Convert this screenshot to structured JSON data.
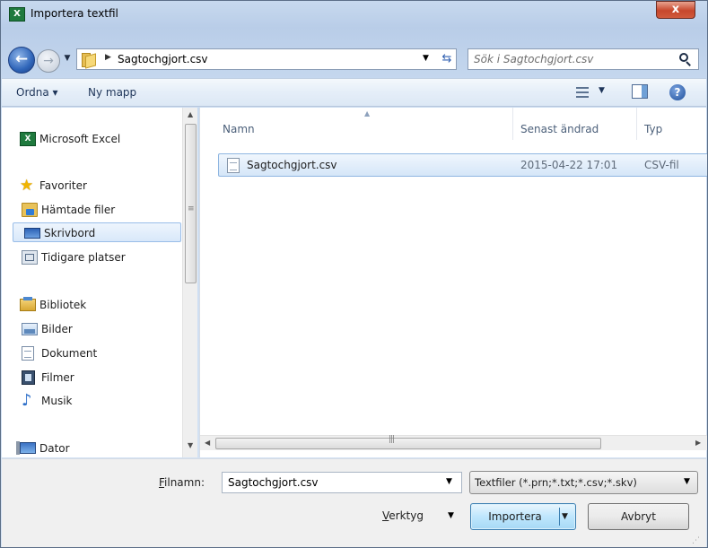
{
  "window": {
    "title": "Importera textfil",
    "app_icon": "excel-icon",
    "close_label": "x"
  },
  "address_bar": {
    "path": "Sagtochgjort.csv",
    "search_placeholder": "Sök i Sagtochgjort.csv"
  },
  "toolbar": {
    "organize_label": "Ordna ▾",
    "new_folder_label": "Ny mapp"
  },
  "nav": {
    "items": [
      {
        "label": "Microsoft Excel",
        "icon": "excel-icon"
      },
      {
        "label": "Favoriter",
        "icon": "star-icon"
      },
      {
        "label": "Hämtade filer",
        "icon": "downloads-folder-icon"
      },
      {
        "label": "Skrivbord",
        "icon": "desktop-icon",
        "selected": true
      },
      {
        "label": "Tidigare platser",
        "icon": "recent-places-icon"
      },
      {
        "label": "Bibliotek",
        "icon": "libraries-icon"
      },
      {
        "label": "Bilder",
        "icon": "pictures-icon"
      },
      {
        "label": "Dokument",
        "icon": "documents-icon"
      },
      {
        "label": "Filmer",
        "icon": "videos-icon"
      },
      {
        "label": "Musik",
        "icon": "music-icon"
      },
      {
        "label": "Dator",
        "icon": "computer-icon"
      }
    ]
  },
  "file_list": {
    "columns": {
      "name": "Namn",
      "modified": "Senast ändrad",
      "type": "Typ"
    },
    "files": [
      {
        "name": "Sagtochgjort.csv",
        "modified": "2015-04-22 17:01",
        "type": "CSV-fil"
      }
    ]
  },
  "bottom": {
    "filename_label_underlined": "F",
    "filename_label_rest": "ilnamn:",
    "filename_value": "Sagtochgjort.csv",
    "filetype_value": "Textfiler (*.prn;*.txt;*.csv;*.skv)",
    "tools_label_underlined": "V",
    "tools_label_rest": "erktyg",
    "import_label": "Importera",
    "cancel_label": "Avbryt"
  }
}
